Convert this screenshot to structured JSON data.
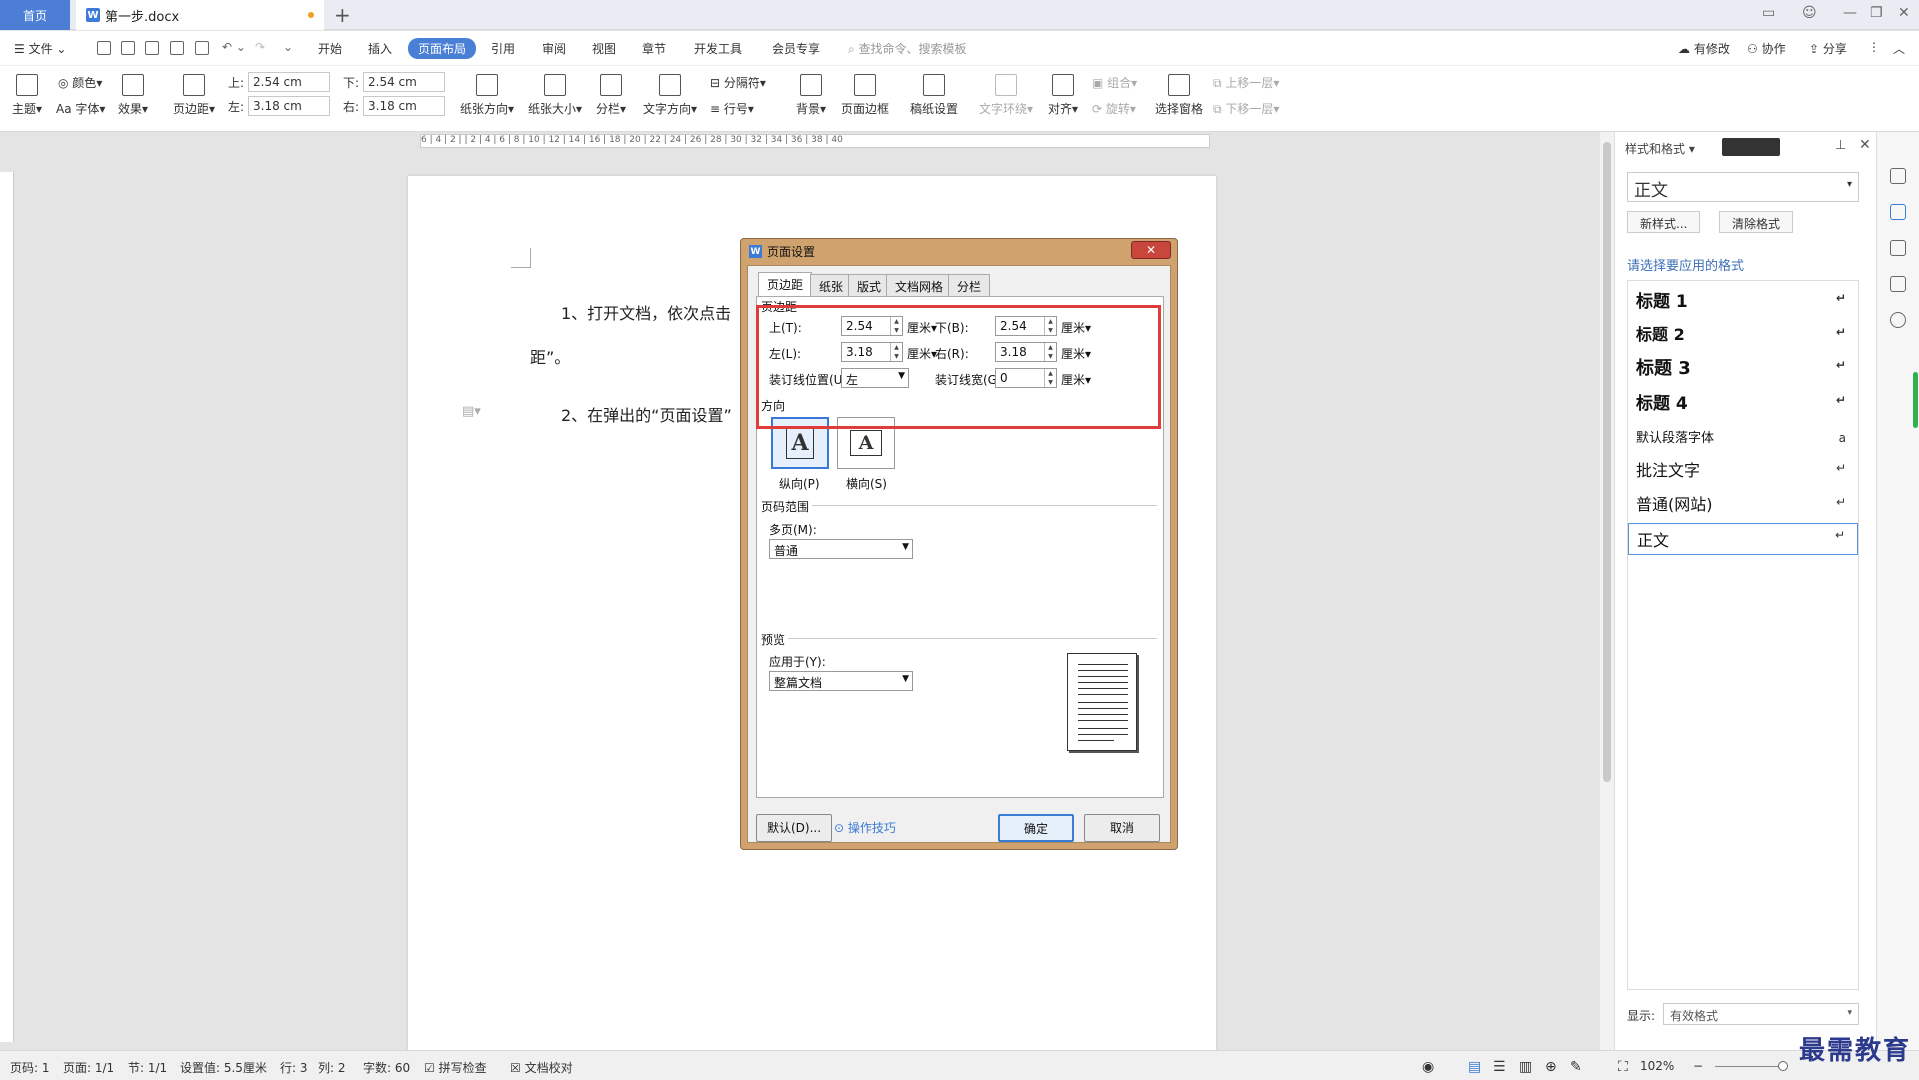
{
  "titlebar": {
    "home_tab": "首页",
    "doc_tab": "第一步.docx",
    "new_tab": "+"
  },
  "menu": {
    "file": "文件",
    "items": [
      "开始",
      "插入",
      "页面布局",
      "引用",
      "审阅",
      "视图",
      "章节",
      "开发工具",
      "会员专享"
    ],
    "active": "页面布局",
    "search_placeholder": "查找命令、搜索模板",
    "has_changes": "有修改",
    "collaborate": "协作",
    "share": "分享"
  },
  "ribbon": {
    "theme": "主题",
    "color": "颜色",
    "font": "字体",
    "effects": "效果",
    "margins": "页边距",
    "top_label": "上:",
    "top_value": "2.54 cm",
    "bottom_label": "下:",
    "bottom_value": "2.54 cm",
    "left_label": "左:",
    "left_value": "3.18 cm",
    "right_label": "右:",
    "right_value": "3.18 cm",
    "orientation": "纸张方向",
    "size": "纸张大小",
    "columns": "分栏",
    "text_direction": "文字方向",
    "separator": "分隔符",
    "line_number": "行号",
    "background": "背景",
    "page_border": "页面边框",
    "manuscript": "稿纸设置",
    "text_wrap": "文字环绕",
    "align": "对齐",
    "group": "组合",
    "rotate": "旋转",
    "selection_pane": "选择窗格",
    "bring_forward": "上移一层",
    "send_backward": "下移一层"
  },
  "ruler": {
    "h_ticks": "6 | 4 | 2 |   | 2 | 4 | 6 | 8 | 10 | 12 | 14 | 16 | 18 | 20 | 22 | 24 | 26 | 28 | 30 | 32 | 34 | 36 | 38 | 40"
  },
  "document": {
    "para1": "1、打开文档，依次点击",
    "para1_tail": "距”。",
    "para2": "2、在弹出的“页面设置”"
  },
  "dialog": {
    "title": "页面设置",
    "close": "✕",
    "tabs": [
      "页边距",
      "纸张",
      "版式",
      "文档网格",
      "分栏"
    ],
    "active_tab": "页边距",
    "margins_group": "页边距",
    "top_label": "上(T):",
    "top_value": "2.54",
    "bottom_label": "下(B):",
    "bottom_value": "2.54",
    "left_label": "左(L):",
    "left_value": "3.18",
    "right_label": "右(R):",
    "right_value": "3.18",
    "gutter_pos_label": "装订线位置(U):",
    "gutter_pos_value": "左",
    "gutter_width_label": "装订线宽(G):",
    "gutter_width_value": "0",
    "unit": "厘米",
    "orientation_group": "方向",
    "portrait": "纵向(P)",
    "landscape": "横向(S)",
    "pages_group": "页码范围",
    "multiple_pages_label": "多页(M):",
    "multiple_pages_value": "普通",
    "preview_group": "预览",
    "apply_to_label": "应用于(Y):",
    "apply_to_value": "整篇文档",
    "default_btn": "默认(D)...",
    "tips": "操作技巧",
    "ok": "确定",
    "cancel": "取消"
  },
  "rightpane": {
    "title": "样式和格式",
    "current_style": "正文",
    "new_style": "新样式...",
    "clear_format": "清除格式",
    "subtitle": "请选择要应用的格式",
    "styles": [
      {
        "label": "标题  1",
        "mark": "↵"
      },
      {
        "label": "标题  2",
        "mark": "↵"
      },
      {
        "label": "标题  3",
        "mark": "↵"
      },
      {
        "label": "标题  4",
        "mark": "↵"
      },
      {
        "label": "默认段落字体",
        "mark": "a"
      },
      {
        "label": "批注文字",
        "mark": "↵"
      },
      {
        "label": "普通(网站)",
        "mark": "↵"
      },
      {
        "label": "正文",
        "mark": "↵"
      }
    ],
    "show_label": "显示:",
    "show_value": "有效格式"
  },
  "status": {
    "page_num": "页码: 1",
    "pages": "页面: 1/1",
    "section": "节: 1/1",
    "setting": "设置值: 5.5厘米",
    "row": "行: 3",
    "col": "列: 2",
    "words": "字数: 60",
    "spell": "拼写检查",
    "proof": "文档校对",
    "zoom": "102%"
  },
  "watermark": "最需教育"
}
